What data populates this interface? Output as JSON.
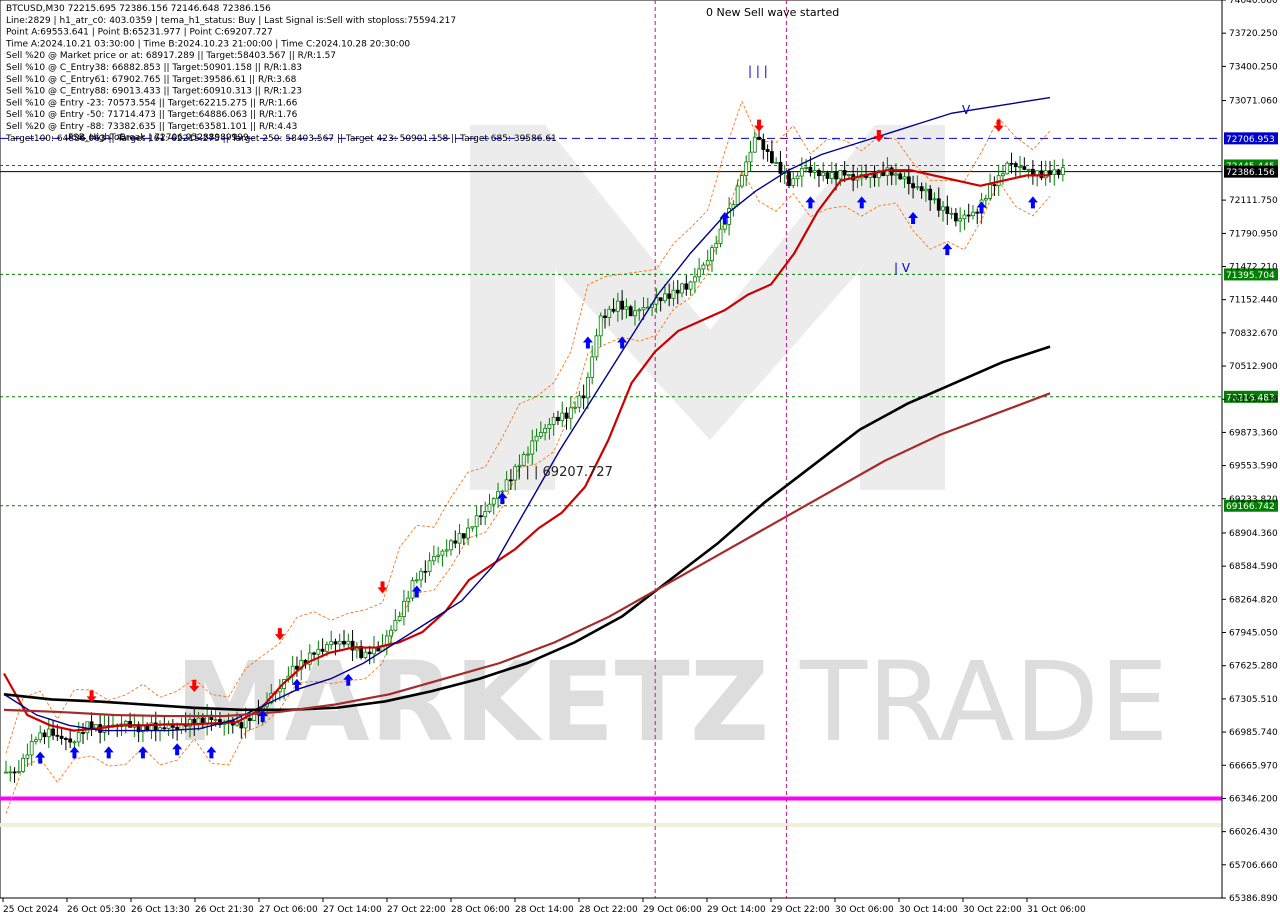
{
  "header": {
    "lines": [
      "BTCUSD,M30  72215.695 72386.156 72146.648 72386.156",
      "Line:2829  |  h1_atr_c0: 403.0359  |  tema_h1_status: Buy  |  Last Signal is:Sell with stoploss:75594.217",
      "Point A:69553.641  |  Point B:65231.977  |  Point C:69207.727",
      "Time A:2024.10.21 03:30:00  |  Time B:2024.10.23 21:00:00  |  Time C:2024.10.28 20:30:00",
      "Sell %20 @ Market price or at: 68917.289  ||  Target:58403.567  ||  R/R:1.57",
      "Sell %10 @ C_Entry38: 66882.853  ||  Target:50901.158  ||  R/R:1.83",
      "Sell %10 @ C_Entry61: 67902.765  ||  Target:39586.61  ||  R/R:3.68",
      "Sell %10 @ C_Entry88: 69013.433  ||  Target:60910.313  ||  R/R:1.23",
      "Sell %10 @ Entry -23: 70573.554  ||  Target:62215.275  ||  R/R:1.66",
      "Sell %10 @ Entry -50: 71714.473  ||  Target:64886.063  ||  R/R:1.76",
      "Sell %20 @ Entry -88: 73382.635  ||  Target:63581.101  ||  R/R:4.43",
      "Target100: 64886.063  ||  Target 161: 62215.275  ||  Target 250: 58403.567  ||  Target 423: 50901.158  ||  Target 685: 39586.61"
    ],
    "fsb_label": "FSB_HighToBreak  |  72706.95288989999"
  },
  "annotations": {
    "wave_label": "0 New Sell wave started",
    "point_c_label": "| | | 69207.727",
    "wave_marks": "| | |",
    "low_marks": "| V",
    "v_mark": "V"
  },
  "watermark": {
    "text_left": "MARKETZ",
    "text_right": "TRADE"
  },
  "colors": {
    "bullish_candle": "#008000",
    "bearish_candle": "#000000",
    "ma_fast": "#cc0000",
    "ma_mid": "#00008b",
    "ma_slow": "#000000",
    "ma_slowest": "#a52a2a",
    "level_line_magenta": "#ff00ff",
    "level_line_beige": "#f5f5dc",
    "dashed_green": "#008000",
    "dashed_blue": "#0000cd",
    "dashed_magenta": "#c71585",
    "buy_arrow": "#0000ff",
    "sell_arrow": "#ff0000"
  },
  "chart_data": {
    "type": "line",
    "title": "BTCUSD,M30",
    "symbol": "BTCUSD",
    "timeframe": "M30",
    "ohlc_last": {
      "open": 72215.695,
      "high": 72386.156,
      "low": 72146.648,
      "close": 72386.156
    },
    "ylim": [
      65386.89,
      74040.06
    ],
    "y_ticks": [
      74040.06,
      73720.25,
      73400.25,
      73071.06,
      72111.75,
      71790.95,
      71472.21,
      71152.44,
      70832.67,
      70512.9,
      70193.13,
      69873.36,
      69553.59,
      69233.82,
      68904.36,
      68584.59,
      68264.82,
      67945.05,
      67625.28,
      67305.51,
      66985.74,
      66665.97,
      66346.2,
      66026.43,
      65706.66,
      65386.89
    ],
    "y_ticks_labels": [
      "74040.060",
      "73720.250",
      "73400.250",
      "73071.060",
      "72111.750",
      "71790.950",
      "71472.210",
      "71152.440",
      "70832.670",
      "70512.900",
      "70193.130",
      "69873.360",
      "69553.590",
      "69233.820",
      "68904.360",
      "68584.590",
      "68264.820",
      "67945.050",
      "67625.280",
      "67305.510",
      "66985.740",
      "66665.970",
      "66346.200",
      "66026.430",
      "65706.660",
      "65386.890"
    ],
    "x_tick_labels": [
      "25 Oct 2024",
      "26 Oct 05:30",
      "26 Oct 13:30",
      "26 Oct 21:30",
      "27 Oct 06:00",
      "27 Oct 14:00",
      "27 Oct 22:00",
      "28 Oct 06:00",
      "28 Oct 14:00",
      "28 Oct 22:00",
      "29 Oct 06:00",
      "29 Oct 14:00",
      "29 Oct 22:00",
      "30 Oct 06:00",
      "30 Oct 14:00",
      "30 Oct 22:00",
      "31 Oct 06:00"
    ],
    "levels": [
      {
        "value": 72706.953,
        "label": "72706.953",
        "style": "dashed",
        "color": "#0000cd",
        "label_bg": "#0000cd"
      },
      {
        "value": 72445.445,
        "label": "72445.445",
        "style": "dashed",
        "color": "#008000",
        "label_bg": "#008000"
      },
      {
        "value": 72386.156,
        "label": "72386.156",
        "style": "solid",
        "color": "#000000",
        "label_bg": "#000000"
      },
      {
        "value": 71395.704,
        "label": "71395.704",
        "style": "dashed",
        "color": "#008000",
        "label_bg": "#008000"
      },
      {
        "value": 70216.483,
        "label": "70216.483",
        "style": "dashed",
        "color": "#008000",
        "label_bg": "#008000"
      },
      {
        "value": 69166.742,
        "label": "69166.742",
        "style": "dashed",
        "color": "#008000",
        "label_bg": "#008000"
      },
      {
        "value": 66346.2,
        "label": "",
        "style": "solid-thick",
        "color": "#ff00ff",
        "label_bg": ""
      },
      {
        "value": 66090.0,
        "label": "",
        "style": "solid-thick",
        "color": "#f0f0d8",
        "label_bg": ""
      }
    ],
    "vlines_x_index": [
      9.8,
      11.85
    ],
    "close_series": [
      66600,
      66950,
      67000,
      66900,
      67050,
      67000,
      67050,
      67020,
      67050,
      67050,
      67080,
      67100,
      67050,
      67050,
      67200,
      67400,
      67600,
      67700,
      67800,
      67850,
      67750,
      67800,
      68050,
      68400,
      68600,
      68750,
      68900,
      69100,
      69300,
      69500,
      69750,
      69950,
      70050,
      70250,
      71000,
      71100,
      71000,
      71100,
      71200,
      71300,
      71500,
      71800,
      72200,
      72700,
      72500,
      72300,
      72450,
      72350,
      72350,
      72300,
      72350,
      72400,
      72300,
      72200,
      72000,
      71900,
      72000,
      72300,
      72500,
      72400,
      72350,
      72386
    ],
    "series": [
      {
        "name": "MA fast",
        "color": "#cc0000",
        "values": [
          67550,
          67150,
          67050,
          67000,
          67020,
          67050,
          67050,
          67060,
          67060,
          67070,
          67080,
          67200,
          67450,
          67650,
          67750,
          67800,
          67800,
          67850,
          67950,
          68150,
          68450,
          68600,
          68750,
          68950,
          69100,
          69350,
          69800,
          70350,
          70650,
          70850,
          70950,
          71050,
          71200,
          71300,
          71600,
          72000,
          72300,
          72350,
          72400,
          72400,
          72350,
          72300,
          72250,
          72300,
          72350,
          72350
        ]
      },
      {
        "name": "MA mid",
        "color": "#00008b",
        "values": [
          67350,
          67150,
          67050,
          67000,
          67000,
          67000,
          67020,
          67100,
          67250,
          67400,
          67500,
          67650,
          67850,
          68050,
          68250,
          68600,
          69150,
          69700,
          70200,
          70700,
          71200,
          71600,
          71950,
          72200,
          72400,
          72550,
          72650,
          72750,
          72850,
          72950,
          73000,
          73050,
          73100
        ]
      },
      {
        "name": "MA slow",
        "color": "#000000",
        "values": [
          67350,
          67300,
          67280,
          67250,
          67220,
          67200,
          67200,
          67220,
          67280,
          67380,
          67500,
          67650,
          67850,
          68100,
          68450,
          68800,
          69200,
          69550,
          69900,
          70150,
          70350,
          70550,
          70700
        ]
      },
      {
        "name": "MA slowest",
        "color": "#a52a2a",
        "values": [
          67200,
          67180,
          67150,
          67140,
          67140,
          67180,
          67250,
          67350,
          67500,
          67650,
          67850,
          68100,
          68400,
          68700,
          69000,
          69300,
          69600,
          69850,
          70050,
          70250
        ]
      }
    ]
  }
}
